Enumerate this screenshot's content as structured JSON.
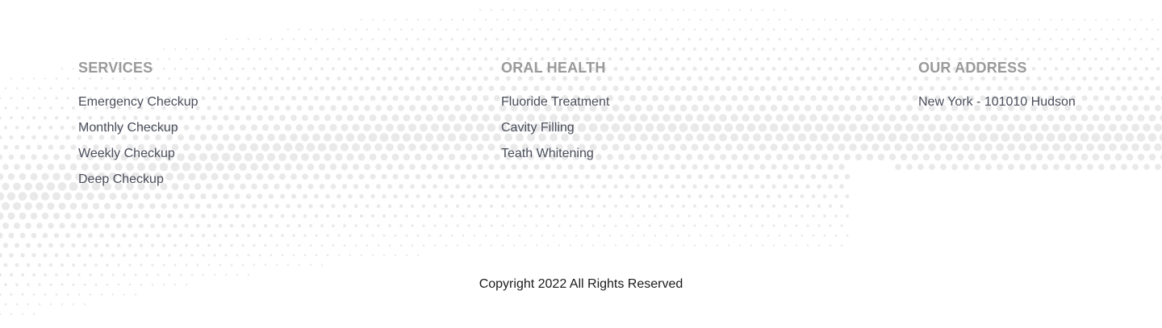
{
  "footer": {
    "columns": [
      {
        "heading": "SERVICES",
        "items": [
          "Emergency Checkup",
          "Monthly Checkup",
          "Weekly Checkup",
          "Deep Checkup"
        ]
      },
      {
        "heading": "ORAL HEALTH",
        "items": [
          "Fluoride Treatment",
          "Cavity Filling",
          "Teath Whitening"
        ]
      },
      {
        "heading": "OUR ADDRESS",
        "items": [
          "New York - 101010 Hudson"
        ]
      }
    ],
    "copyright": "Copyright 2022 All Rights Reserved",
    "colors": {
      "heading": "#9a9a9a",
      "link": "#4a4d5a",
      "dots": "#e9e9e9"
    }
  }
}
